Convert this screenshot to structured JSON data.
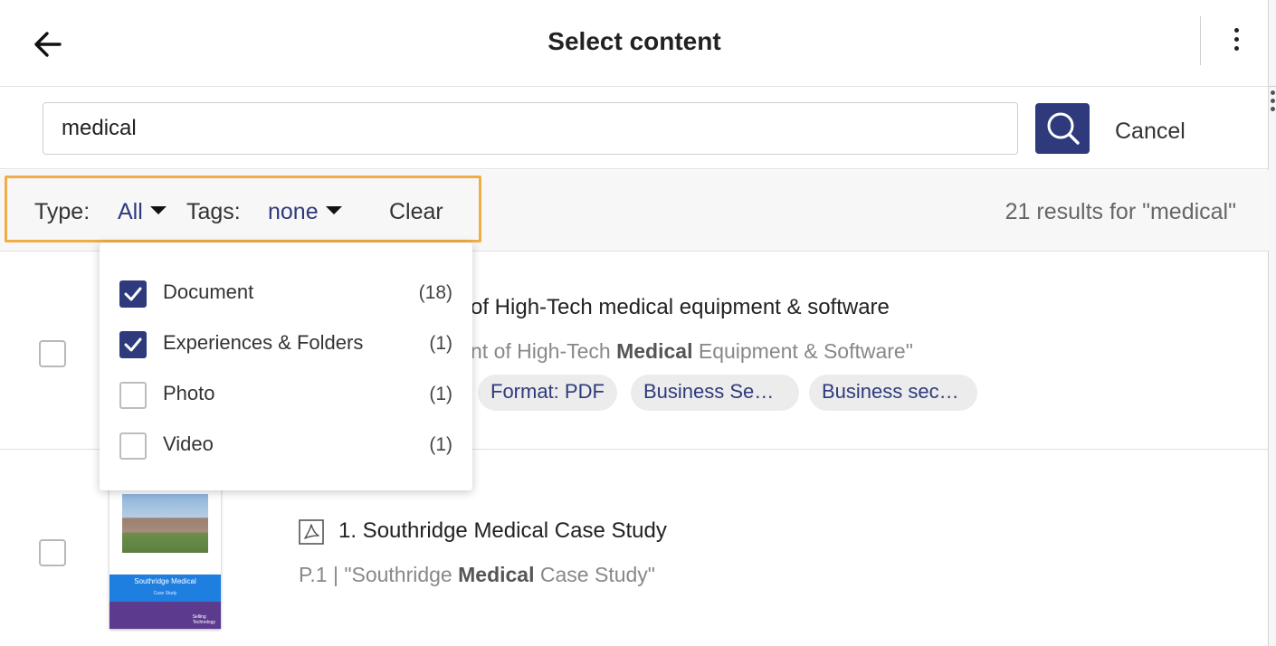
{
  "header": {
    "title": "Select content",
    "back_icon": "arrow-left-icon",
    "more_icon": "more-vertical-icon"
  },
  "search": {
    "value": "medical",
    "button_icon": "search-icon",
    "cancel_label": "Cancel"
  },
  "filters": {
    "type_label": "Type:",
    "type_value": "All",
    "tags_label": "Tags:",
    "tags_value": "none",
    "clear_label": "Clear",
    "results_text": "21 results for \"medical\"",
    "highlight_color": "#f0ad45"
  },
  "type_dropdown": {
    "items": [
      {
        "label": "Document",
        "count": "(18)",
        "checked": true
      },
      {
        "label": "Experiences & Folders",
        "count": "(1)",
        "checked": true
      },
      {
        "label": "Photo",
        "count": "(1)",
        "checked": false
      },
      {
        "label": "Video",
        "count": "(1)",
        "checked": false
      }
    ]
  },
  "results": [
    {
      "title": "of High-Tech medical equipment & software",
      "snippet_pre": "nt of High-Tech ",
      "snippet_bold": "Medical",
      "snippet_post": " Equipment & Software\"",
      "tags": [
        "Format: PDF",
        "Business Se…",
        "Business sec…"
      ]
    },
    {
      "title": "1. Southridge Medical Case Study",
      "snippet_pre": "P.1 | \"Southridge ",
      "snippet_bold": "Medical",
      "snippet_post": " Case Study\"",
      "file_icon": "pdf-icon",
      "thumbnail": {
        "title": "Southridge Medical",
        "subtitle": "Case Study",
        "brand_line1": "Selling",
        "brand_line2": "Technology"
      }
    }
  ],
  "colors": {
    "accent": "#2e3a7c",
    "thumbnail_blue": "#1e7fe0",
    "thumbnail_purple": "#5c3b8e"
  }
}
